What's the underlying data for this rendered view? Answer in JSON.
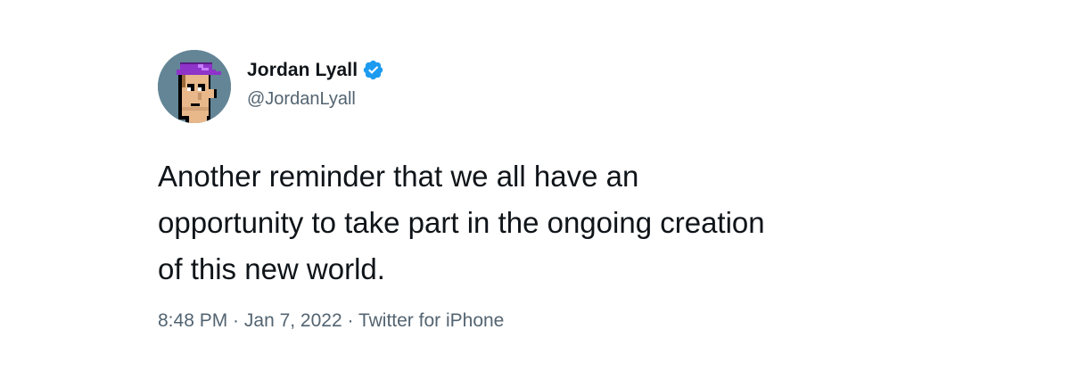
{
  "tweet": {
    "author": {
      "display_name": "Jordan Lyall",
      "handle": "@JordanLyall",
      "verified": true,
      "avatar_icon": "cryptopunk-avatar-icon"
    },
    "text": "Another reminder that we all have an\nopportunity to take part in the ongoing creation\nof this new world.",
    "time": "8:48 PM",
    "separator": " · ",
    "date": "Jan 7, 2022",
    "source": "Twitter for iPhone"
  },
  "colors": {
    "text_primary": "#0f1419",
    "text_secondary": "#536471",
    "verified_blue": "#1d9bf0",
    "avatar_background": "#638596"
  }
}
